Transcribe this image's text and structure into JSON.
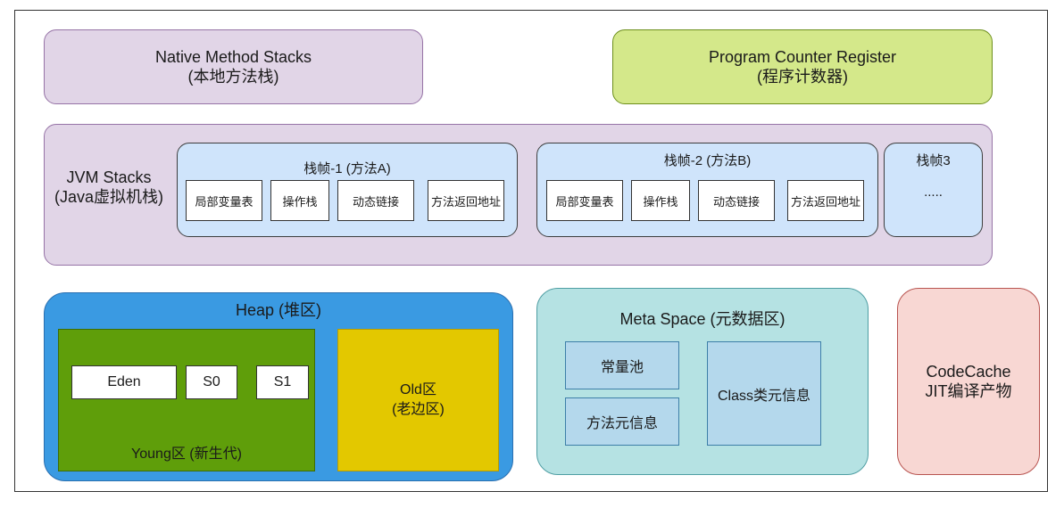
{
  "native_stacks": {
    "line1": "Native Method Stacks",
    "line2": "(本地方法栈)"
  },
  "pc_register": {
    "line1": "Program Counter Register",
    "line2": "(程序计数器)"
  },
  "jvm_stacks": {
    "line1": "JVM Stacks",
    "line2": "(Java虚拟机栈)",
    "frames": [
      {
        "title": "栈帧-1 (方法A)",
        "items": [
          "局部变量表",
          "操作栈",
          "动态链接",
          "方法返回地址"
        ]
      },
      {
        "title": "栈帧-2 (方法B)",
        "items": [
          "局部变量表",
          "操作栈",
          "动态链接",
          "方法返回地址"
        ]
      },
      {
        "title": "栈帧3",
        "ellipsis": "....."
      }
    ]
  },
  "heap": {
    "title": "Heap (堆区)",
    "young": {
      "label": "Young区 (新生代)",
      "eden": "Eden",
      "s0": "S0",
      "s1": "S1"
    },
    "old": {
      "line1": "Old区",
      "line2": "(老边区)"
    }
  },
  "meta_space": {
    "title": "Meta Space (元数据区)",
    "constant_pool": "常量池",
    "method_meta": "方法元信息",
    "class_meta": "Class类元信息"
  },
  "code_cache": {
    "line1": "CodeCache",
    "line2": "JIT编译产物"
  },
  "colors": {
    "purple": "#e1d5e7",
    "green": "#d4e88a",
    "frame_blue": "#cfe4fb",
    "heap_blue": "#3a9ae2",
    "young_green": "#5f9e0a",
    "old_yellow": "#e3c800",
    "meta_teal": "#b5e2e3",
    "cache_pink": "#f8d7d3"
  }
}
